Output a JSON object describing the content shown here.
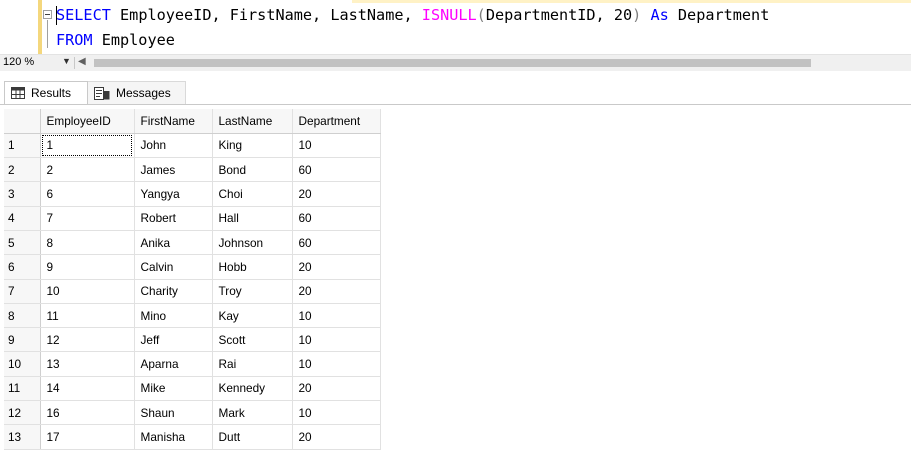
{
  "editor": {
    "line1": {
      "select": "SELECT",
      "columns": "EmployeeID, FirstName, LastName,",
      "isnull": "ISNULL",
      "open_paren": "(",
      "args": "DepartmentID, 20",
      "close_paren": ")",
      "as": "As",
      "alias": "Department"
    },
    "line2": {
      "from": "FROM",
      "table": "Employee"
    }
  },
  "zoom": {
    "value": "120 %"
  },
  "tabs": {
    "results": "Results",
    "messages": "Messages"
  },
  "grid": {
    "columns": [
      "EmployeeID",
      "FirstName",
      "LastName",
      "Department"
    ],
    "rows": [
      {
        "n": "1",
        "id": "1",
        "first": "John",
        "last": "King",
        "dept": "10"
      },
      {
        "n": "2",
        "id": "2",
        "first": "James",
        "last": "Bond",
        "dept": "60"
      },
      {
        "n": "3",
        "id": "6",
        "first": "Yangya",
        "last": "Choi",
        "dept": "20"
      },
      {
        "n": "4",
        "id": "7",
        "first": "Robert",
        "last": "Hall",
        "dept": "60"
      },
      {
        "n": "5",
        "id": "8",
        "first": "Anika",
        "last": "Johnson",
        "dept": "60"
      },
      {
        "n": "6",
        "id": "9",
        "first": "Calvin",
        "last": "Hobb",
        "dept": "20"
      },
      {
        "n": "7",
        "id": "10",
        "first": "Charity",
        "last": "Troy",
        "dept": "20"
      },
      {
        "n": "8",
        "id": "11",
        "first": "Mino",
        "last": "Kay",
        "dept": "10"
      },
      {
        "n": "9",
        "id": "12",
        "first": "Jeff",
        "last": "Scott",
        "dept": "10"
      },
      {
        "n": "10",
        "id": "13",
        "first": "Aparna",
        "last": "Rai",
        "dept": "10"
      },
      {
        "n": "11",
        "id": "14",
        "first": "Mike",
        "last": "Kennedy",
        "dept": "20"
      },
      {
        "n": "12",
        "id": "16",
        "first": "Shaun",
        "last": "Mark",
        "dept": "10"
      },
      {
        "n": "13",
        "id": "17",
        "first": "Manisha",
        "last": "Dutt",
        "dept": "20"
      }
    ]
  }
}
